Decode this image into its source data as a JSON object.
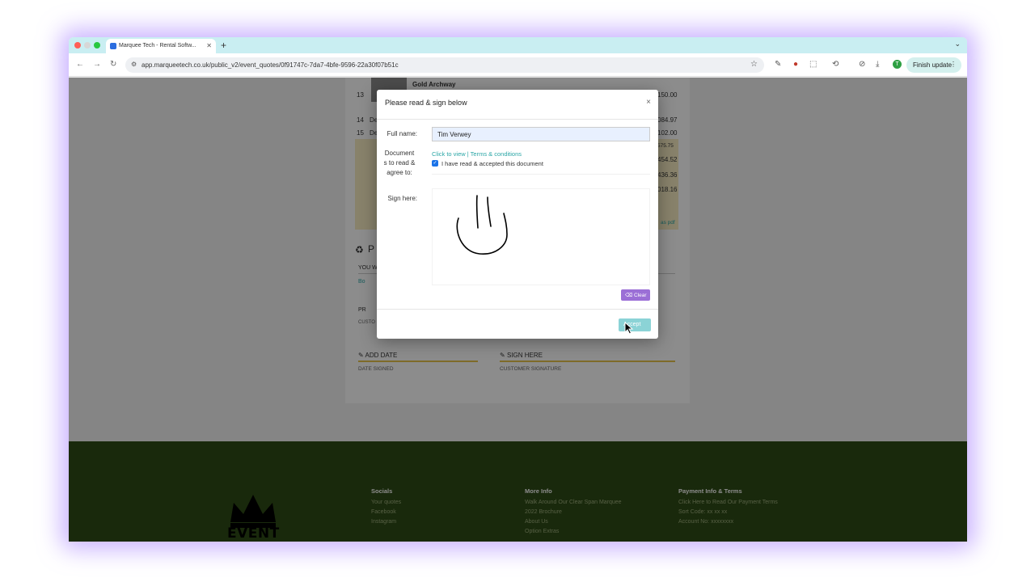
{
  "browser": {
    "tab_title": "Marquee Tech - Rental Softw...",
    "new_tab_symbol": "+",
    "url": "app.marqueetech.co.uk/public_v2/event_quotes/0f91747c-7da7-4bfe-9596-22a30f07b51c",
    "finish_update_label": "Finish update",
    "profile_initial": "T"
  },
  "page": {
    "row_13_num": "13",
    "row_13_item": "Gold Archway",
    "row_13_amount": "150.00",
    "row_14_num": "14",
    "row_14_prefix": "De",
    "row_14_amount": "084.97",
    "row_15_num": "15",
    "row_15_prefix": "De",
    "row_15_amount": "102.00",
    "amount_1": "575.75",
    "amount_2": "454.52",
    "amount_3": "436.36",
    "amount_4": "018.16",
    "pdf_link": "as pdf",
    "section_letter": "P",
    "you_label": "YOU W",
    "bo_label": "Bo",
    "pr_label": "PR",
    "custo_label": "CUSTO",
    "add_date_label": "ADD DATE",
    "date_signed_label": "DATE SIGNED",
    "sign_here_label": "SIGN HERE",
    "customer_signature_label": "CUSTOMER SIGNATURE"
  },
  "footer": {
    "logo_text": "EVENT",
    "socials": {
      "heading": "Socials",
      "links": [
        "Your quotes",
        "Facebook",
        "Instagram"
      ]
    },
    "more_info": {
      "heading": "More Info",
      "links": [
        "Walk Around Our Clear Span Marquee",
        "2022 Brochure",
        "About Us",
        "Option Extras"
      ]
    },
    "payment": {
      "heading": "Payment Info & Terms",
      "links": [
        "Click Here to Read Our Payment Terms",
        "Sort Code: xx xx xx",
        "Account No: xxxxxxxx"
      ]
    }
  },
  "modal": {
    "title": "Please read & sign below",
    "close_symbol": "×",
    "full_name_label": "Full name:",
    "full_name_value": "Tim Verwey",
    "documents_label_1": "Document",
    "documents_label_2": "s to read &",
    "documents_label_3": "agree to:",
    "document_link": "Click to view | Terms & conditions",
    "accepted_label": "I have read & accepted this document",
    "accepted_checked": true,
    "sign_label": "Sign here:",
    "clear_label": "Clear",
    "accept_label": "Accept"
  }
}
